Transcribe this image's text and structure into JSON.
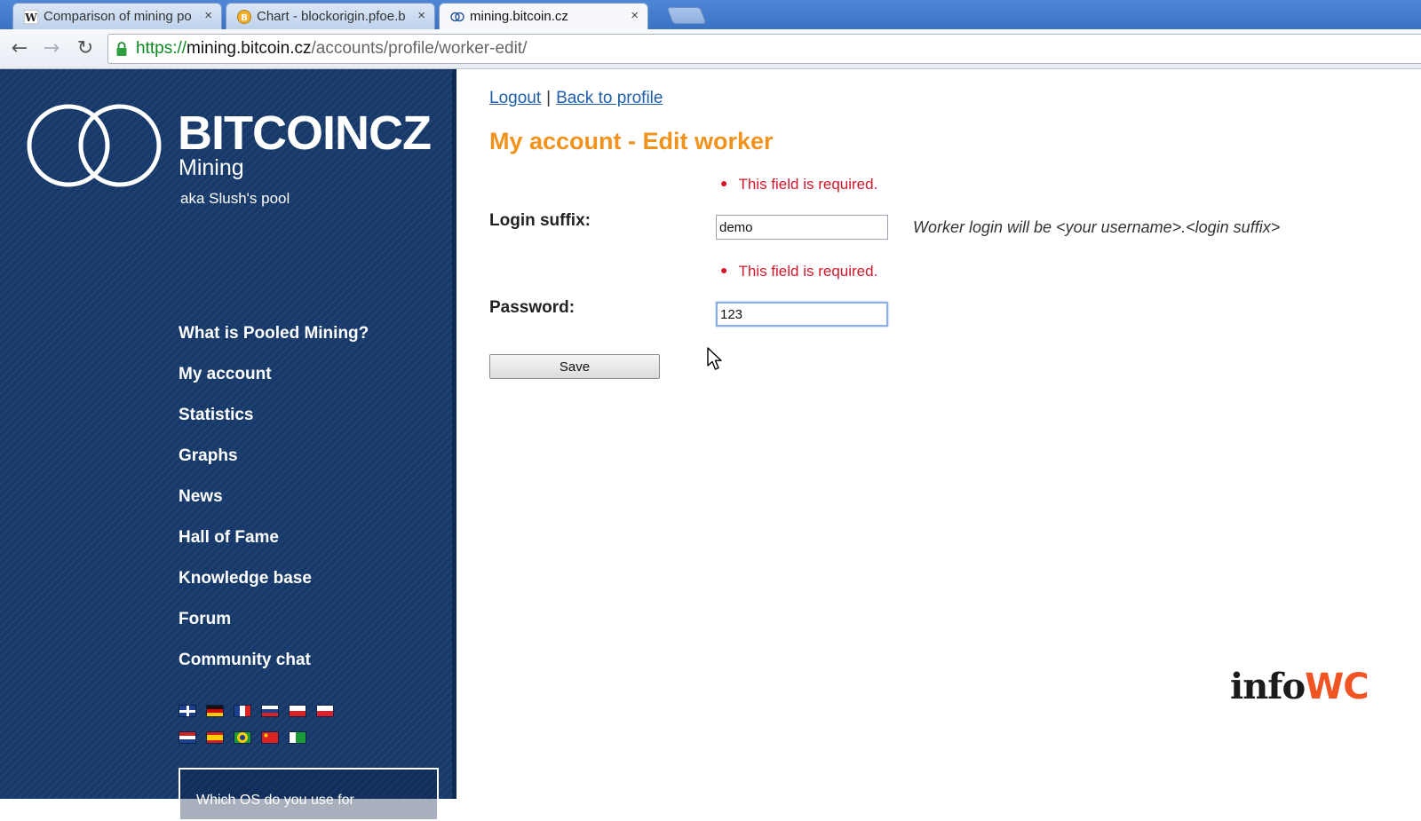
{
  "browser": {
    "tabs": [
      {
        "title": "Comparison of mining po",
        "favicon": "wikipedia-icon",
        "active": false
      },
      {
        "title": "Chart - blockorigin.pfoe.b",
        "favicon": "bitcoin-coin-icon",
        "active": false
      },
      {
        "title": "mining.bitcoin.cz",
        "favicon": "bitcoincz-rings-icon",
        "active": true
      }
    ],
    "close_glyph": "×",
    "url": {
      "scheme": "https://",
      "host": "mining.bitcoin.cz",
      "path": "/accounts/profile/worker-edit/"
    },
    "nav": {
      "back": "←",
      "forward": "→",
      "reload": "↻"
    }
  },
  "sidebar": {
    "brand": "BITCOINCZ",
    "subtitle": "Mining",
    "tagline": "aka Slush's pool",
    "nav_items": [
      "What is Pooled Mining?",
      "My account",
      "Statistics",
      "Graphs",
      "News",
      "Hall of Fame",
      "Knowledge base",
      "Forum",
      "Community chat"
    ],
    "flags": [
      "flag-uk-icon",
      "flag-de-icon",
      "flag-fr-icon",
      "flag-ru-icon",
      "flag-cz-icon",
      "flag-pl-icon",
      "flag-nl-icon",
      "flag-es-icon",
      "flag-br-icon",
      "flag-cn-icon",
      "flag-eo-icon"
    ],
    "poll_text": "Which OS do you use for"
  },
  "content": {
    "links": {
      "logout": "Logout",
      "separator": "|",
      "back": "Back to profile"
    },
    "title": "My account - Edit worker",
    "form": {
      "login_error": "This field is required.",
      "login_label": "Login suffix:",
      "login_value": "demo",
      "login_hint": "Worker login will be <your username>.<login suffix>",
      "password_error": "This field is required.",
      "password_label": "Password:",
      "password_value": "123",
      "save_label": "Save"
    }
  },
  "watermark": {
    "part1": "info",
    "part2": "WC"
  },
  "colors": {
    "sidebar": "#17396a",
    "title": "#f0921c",
    "error": "#d4182a",
    "link": "#1f5fa6",
    "watermark_accent": "#f05423"
  }
}
